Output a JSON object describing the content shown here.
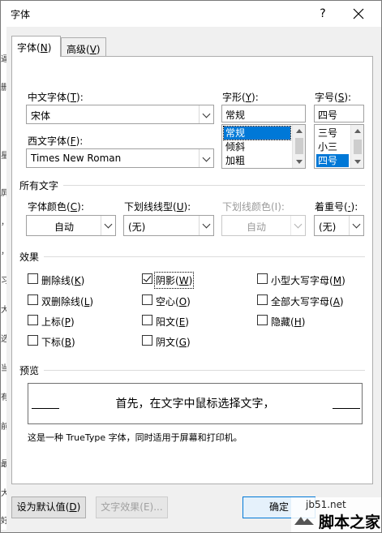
{
  "window": {
    "title": "字体",
    "help": "?",
    "close_icon": "close-icon"
  },
  "left_strip": [
    "逼",
    "删",
    "星",
    "屏",
    "，",
    "，",
    "习",
    "大",
    "选",
    "当",
    "有",
    "前",
    "最",
    "大",
    "好"
  ],
  "tabs": [
    {
      "label": "字体",
      "key": "N"
    },
    {
      "label": "高级",
      "key": "V"
    }
  ],
  "font": {
    "chinese_label": "中文字体",
    "chinese_key": "T",
    "chinese_value": "宋体",
    "western_label": "西文字体",
    "western_key": "F",
    "western_value": "Times New Roman",
    "style_label": "字形",
    "style_key": "Y",
    "style_value": "常规",
    "style_options": [
      "常规",
      "倾斜",
      "加粗"
    ],
    "style_selected": "常规",
    "size_label": "字号",
    "size_key": "S",
    "size_value": "四号",
    "size_options": [
      "三号",
      "小三",
      "四号"
    ],
    "size_selected": "四号"
  },
  "all_text": {
    "section": "所有文字",
    "color_label": "字体颜色",
    "color_key": "C",
    "color_value": "自动",
    "underline_label": "下划线线型",
    "underline_key": "U",
    "underline_value": "(无)",
    "underline_color_label": "下划线颜色(I):",
    "underline_color_value": "自动",
    "emphasis_label": "着重号",
    "emphasis_key": "·",
    "emphasis_value": "(无)"
  },
  "effects": {
    "section": "效果",
    "items": [
      {
        "label": "删除线",
        "key": "K",
        "checked": false
      },
      {
        "label": "阴影",
        "key": "W",
        "checked": true
      },
      {
        "label": "小型大写字母",
        "key": "M",
        "checked": false
      },
      {
        "label": "双删除线",
        "key": "L",
        "checked": false
      },
      {
        "label": "空心",
        "key": "O",
        "checked": false
      },
      {
        "label": "全部大写字母",
        "key": "A",
        "checked": false
      },
      {
        "label": "上标",
        "key": "P",
        "checked": false
      },
      {
        "label": "阳文",
        "key": "E",
        "checked": false
      },
      {
        "label": "隐藏",
        "key": "H",
        "checked": false
      },
      {
        "label": "下标",
        "key": "B",
        "checked": false
      },
      {
        "label": "阴文",
        "key": "G",
        "checked": false
      }
    ]
  },
  "preview": {
    "section": "预览",
    "sample": "首先，在文字中鼠标选择文字，",
    "note": "这是一种 TrueType 字体，同时适用于屏幕和打印机。"
  },
  "buttons": {
    "set_default": "设为默认值",
    "set_default_key": "D",
    "text_effects": "文字效果(E)...",
    "ok": "确定"
  },
  "watermark": {
    "url": "jb51.net",
    "text": "脚本之家"
  }
}
